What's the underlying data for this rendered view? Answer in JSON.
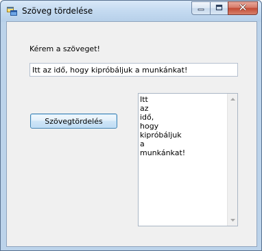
{
  "window": {
    "title": "Szöveg tördelése"
  },
  "caption_buttons": {
    "minimize_icon": "minimize-icon",
    "maximize_icon": "maximize-icon",
    "close_icon": "close-icon"
  },
  "form": {
    "prompt_label": "Kérem a szöveget!",
    "input_value": "Itt az idő, hogy kipróbáljuk a munkánkat!",
    "wrap_button_label": "Szövegtördelés",
    "output_lines": [
      "Itt",
      "az",
      "idő,",
      "hogy",
      "kipróbáljuk",
      "a",
      "munkánkat!"
    ]
  }
}
